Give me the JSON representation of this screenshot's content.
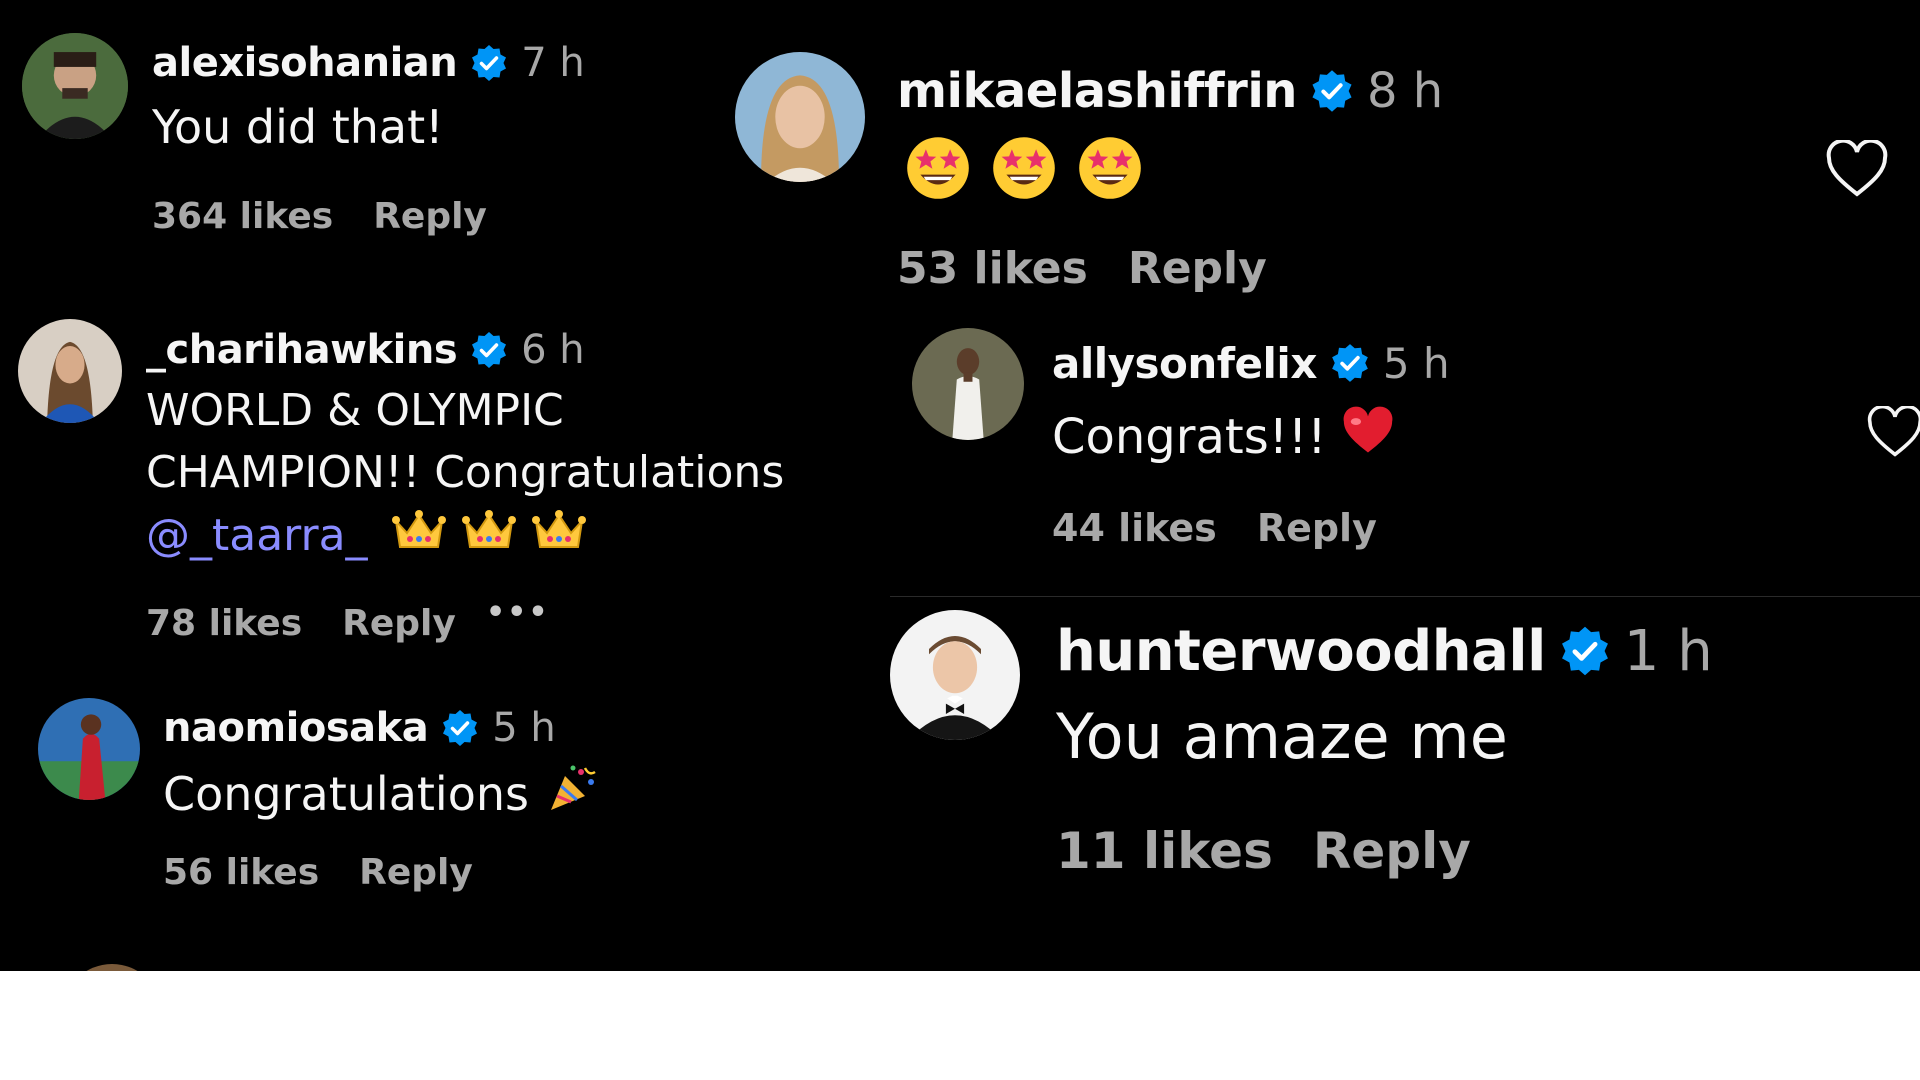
{
  "colors": {
    "background": "#000000",
    "text": "#f5f5f5",
    "secondary": "#a8a8a8",
    "verified": "#0095f6",
    "mention": "#8a8cff"
  },
  "comments": [
    {
      "username": "alexisohanian",
      "time": "7 h",
      "text": "You did that!",
      "likes": "364 likes",
      "reply": "Reply",
      "verified": true
    },
    {
      "username": "mikaelashiffrin",
      "time": "8 h",
      "text": "",
      "emojis": [
        "star-struck-emoji",
        "star-struck-emoji",
        "star-struck-emoji"
      ],
      "likes": "53 likes",
      "reply": "Reply",
      "verified": true
    },
    {
      "username": "_charihawkins",
      "time": "6 h",
      "text_line1": "WORLD & OLYMPIC",
      "text_line2": "CHAMPION!! Congratulations",
      "mention": "@_taarra_",
      "emojis": [
        "crown-emoji",
        "crown-emoji",
        "crown-emoji"
      ],
      "likes": "78 likes",
      "reply": "Reply",
      "more": "•••",
      "verified": true
    },
    {
      "username": "allysonfelix",
      "time": "5 h",
      "text": "Congrats!!!",
      "emojis": [
        "red-heart-emoji"
      ],
      "likes": "44 likes",
      "reply": "Reply",
      "verified": true
    },
    {
      "username": "naomiosaka",
      "time": "5 h",
      "text": "Congratulations",
      "emojis": [
        "party-popper-emoji"
      ],
      "likes": "56 likes",
      "reply": "Reply",
      "verified": true
    },
    {
      "username": "hunterwoodhall",
      "time": "1 h",
      "text": "You amaze me",
      "likes": "11 likes",
      "reply": "Reply",
      "verified": true
    }
  ]
}
